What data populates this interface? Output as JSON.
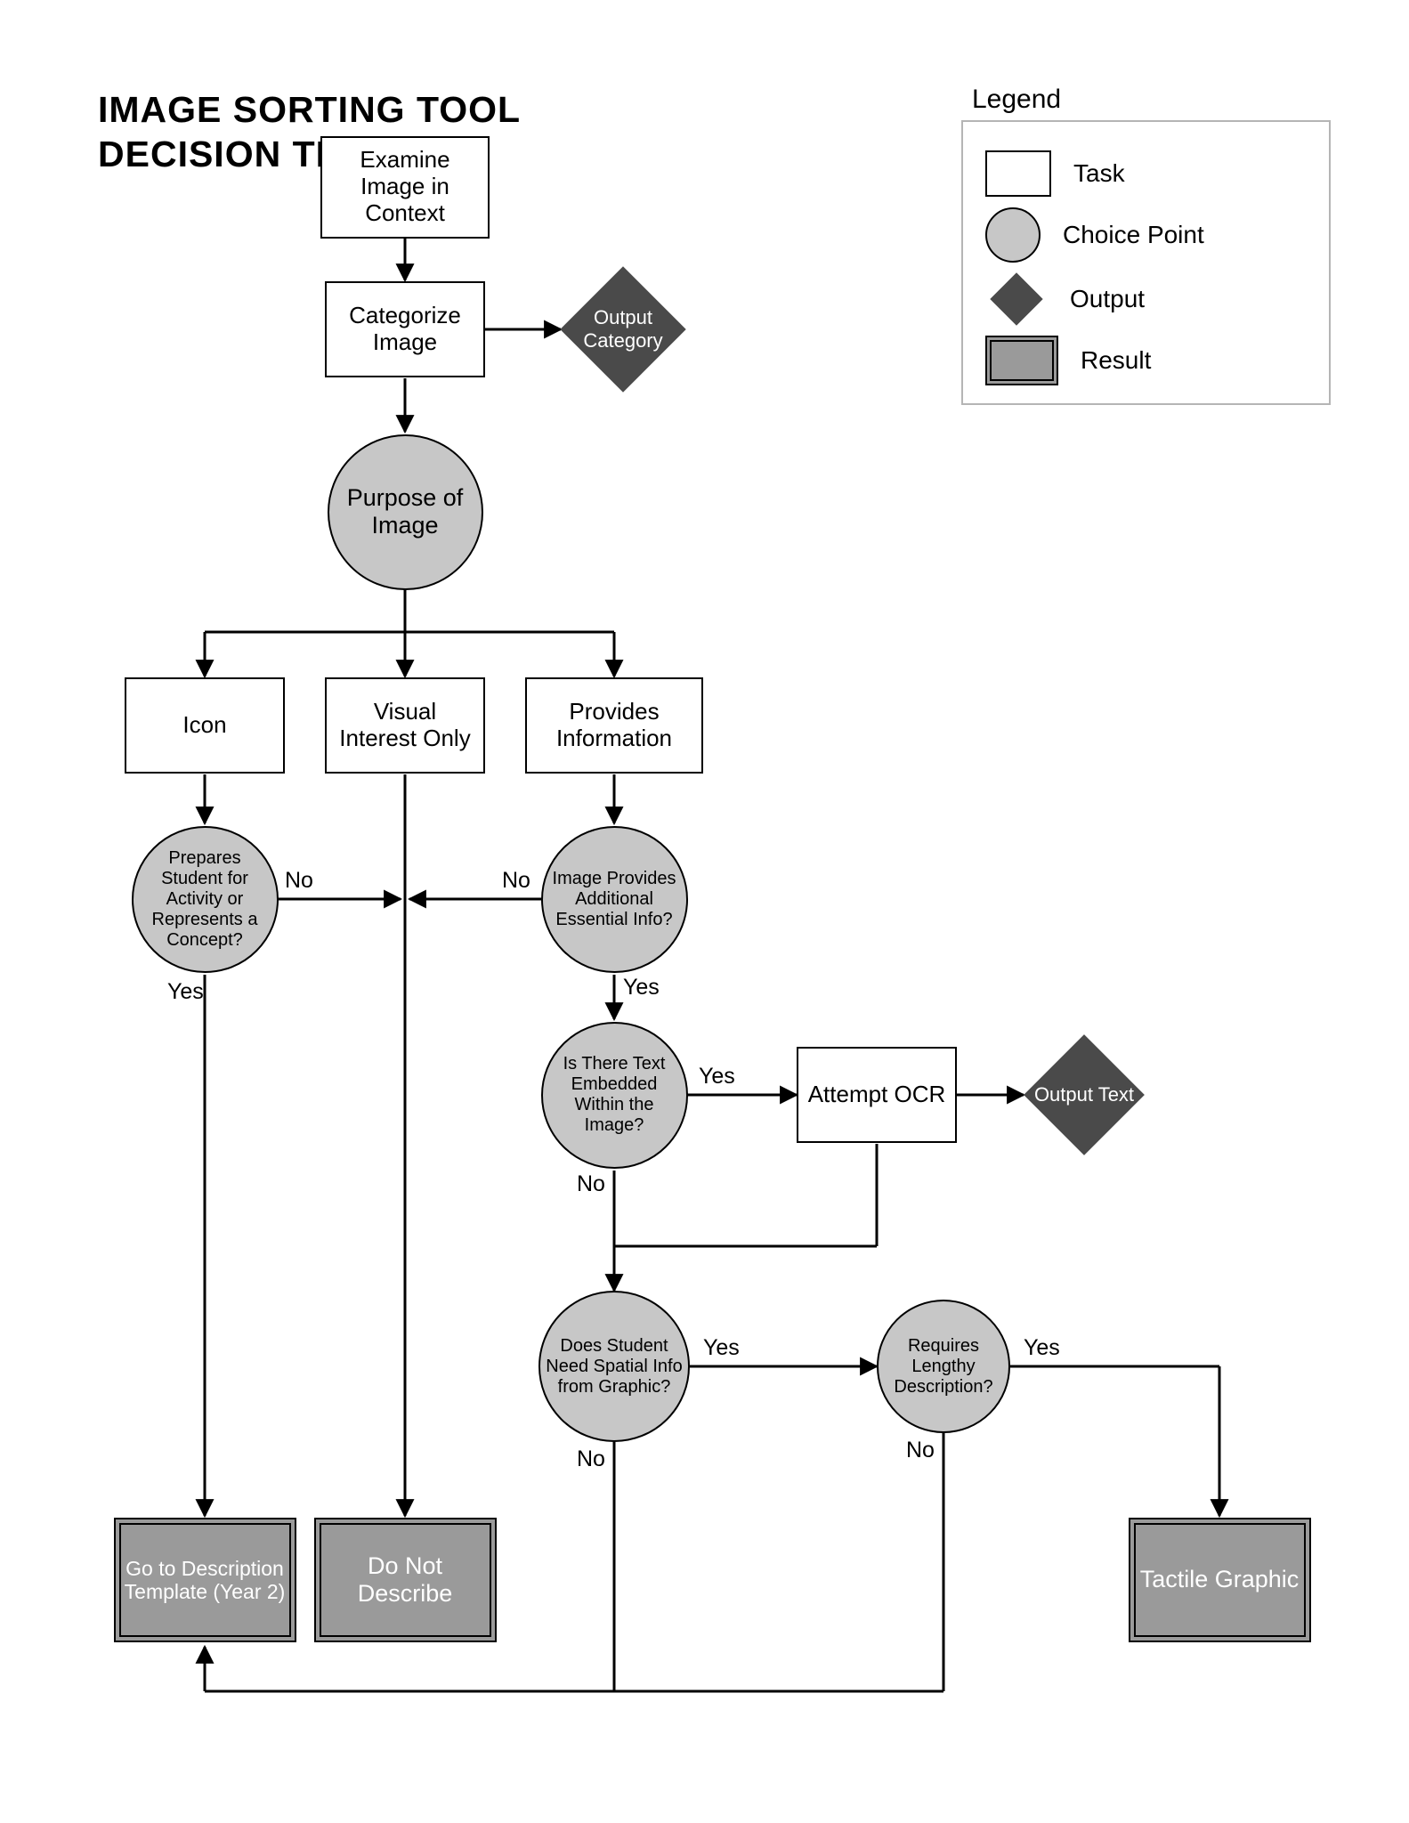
{
  "title_line1": "IMAGE SORTING TOOL",
  "title_line2": "DECISION TREE",
  "legend": {
    "heading": "Legend",
    "task": "Task",
    "choice": "Choice Point",
    "output": "Output",
    "result": "Result"
  },
  "nodes": {
    "examine": "Examine Image in Context",
    "categorize": "Categorize Image",
    "out_cat": "Output Category",
    "purpose": "Purpose of Image",
    "icon": "Icon",
    "visual": "Visual Interest Only",
    "provides": "Provides Information",
    "prepares": "Prepares Student for Activity or Represents a Concept?",
    "essential": "Image Provides Additional Essential Info?",
    "embedded": "Is There Text Embedded Within the Image?",
    "ocr": "Attempt OCR",
    "out_text": "Output Text",
    "spatial": "Does Student Need Spatial Info from Graphic?",
    "lengthy": "Requires Lengthy Description?",
    "goto": "Go to Description Template (Year 2)",
    "donot": "Do Not Describe",
    "tactile": "Tactile Graphic"
  },
  "labels": {
    "yes": "Yes",
    "no": "No"
  }
}
